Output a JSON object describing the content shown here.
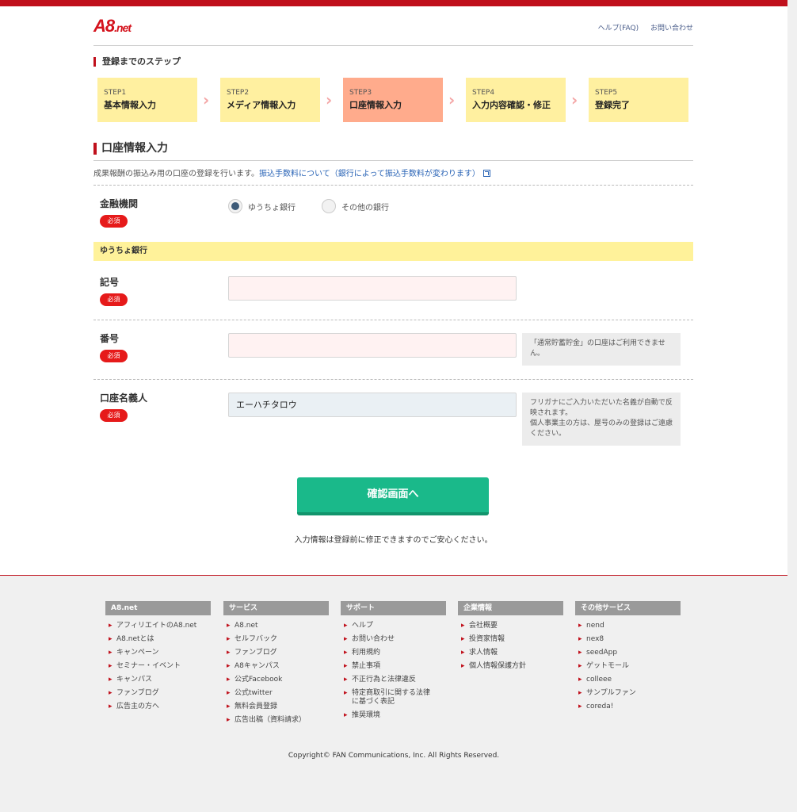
{
  "header": {
    "logo_main": "A8",
    "logo_suffix": ".net",
    "help_link": "ヘルプ(FAQ)",
    "contact_link": "お問い合わせ"
  },
  "steps_label": "登録までのステップ",
  "steps": [
    {
      "num": "STEP1",
      "label": "基本情報入力",
      "active": false
    },
    {
      "num": "STEP2",
      "label": "メディア情報入力",
      "active": false
    },
    {
      "num": "STEP3",
      "label": "口座情報入力",
      "active": true
    },
    {
      "num": "STEP4",
      "label": "入力内容確認・修正",
      "active": false
    },
    {
      "num": "STEP5",
      "label": "登録完了",
      "active": false
    }
  ],
  "page_title": "口座情報入力",
  "intro": {
    "text": "成果報酬の振込み用の口座の登録を行います。",
    "link": "振込手数料について（銀行によって振込手数料が変わります）"
  },
  "required_label": "必須",
  "bank": {
    "label": "金融機関",
    "options": [
      {
        "label": "ゆうちょ銀行",
        "checked": true
      },
      {
        "label": "その他の銀行",
        "checked": false
      }
    ]
  },
  "band_title": "ゆうちょ銀行",
  "fields": {
    "kigou": {
      "label": "記号",
      "value": ""
    },
    "bangou": {
      "label": "番号",
      "value": "",
      "note": "「通常貯蓄貯金」の口座はご利用できません。"
    },
    "meigi": {
      "label": "口座名義人",
      "value": "エーハチタロウ",
      "note": "フリガナにご入力いただいた名義が自動で反映されます。\n個人事業主の方は、屋号のみの登録はご遠慮ください。"
    }
  },
  "confirm_button": "確認画面へ",
  "reassure": "入力情報は登録前に修正できますのでご安心ください。",
  "footer": {
    "columns": [
      {
        "title": "A8.net",
        "items": [
          "アフィリエイトのA8.net",
          "A8.netとは",
          "キャンペーン",
          "セミナー・イベント",
          "キャンパス",
          "ファンブログ",
          "広告主の方へ"
        ]
      },
      {
        "title": "サービス",
        "items": [
          "A8.net",
          "セルフバック",
          "ファンブログ",
          "A8キャンパス",
          "公式Facebook",
          "公式twitter",
          "無料会員登録",
          "広告出稿（資料請求）"
        ]
      },
      {
        "title": "サポート",
        "items": [
          "ヘルプ",
          "お問い合わせ",
          "利用規約",
          "禁止事項",
          "不正行為と法律違反",
          "特定商取引に関する法律に基づく表記",
          "推奨環境"
        ]
      },
      {
        "title": "企業情報",
        "items": [
          "会社概要",
          "投資家情報",
          "求人情報",
          "個人情報保護方針"
        ]
      },
      {
        "title": "その他サービス",
        "items": [
          "nend",
          "nex8",
          "seedApp",
          "ゲットモール",
          "colleee",
          "サンプルファン",
          "coreda!"
        ]
      }
    ],
    "copyright": "Copyright© FAN Communications, Inc. All Rights Reserved."
  }
}
